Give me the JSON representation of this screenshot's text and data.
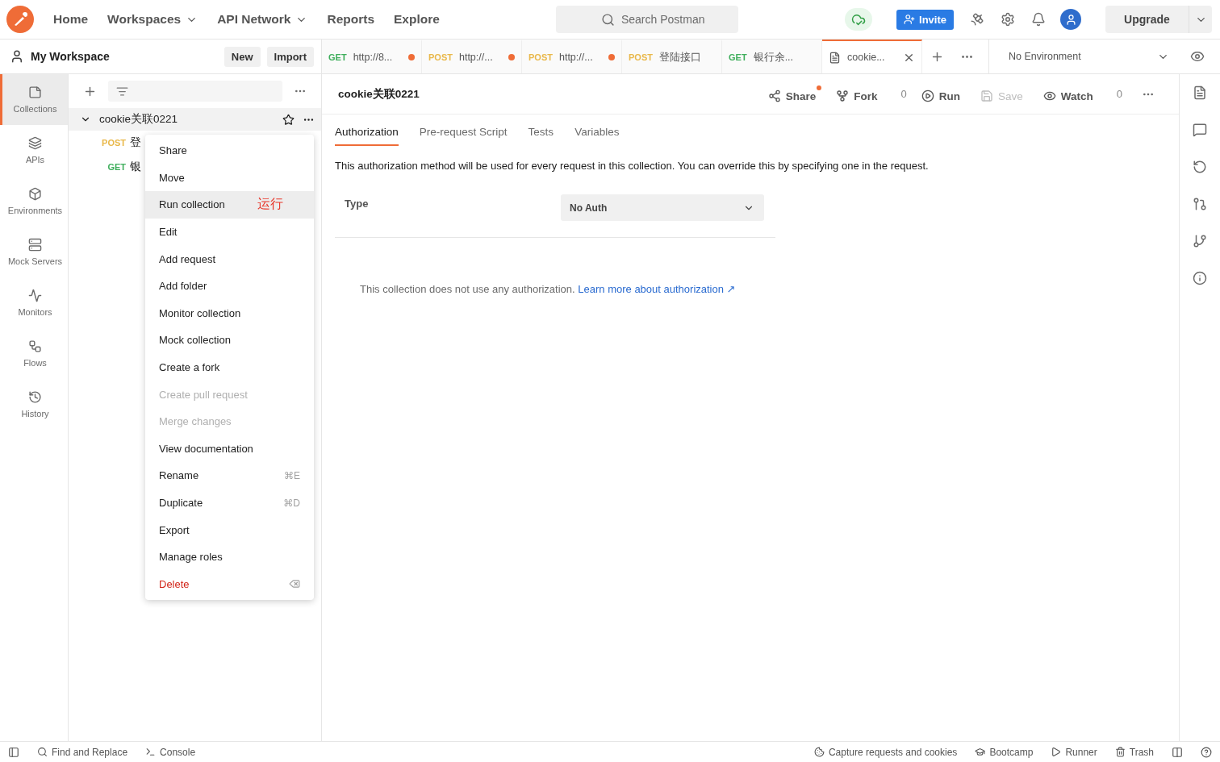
{
  "nav": [
    {
      "label": "Home",
      "dropdown": false
    },
    {
      "label": "Workspaces",
      "dropdown": true
    },
    {
      "label": "API Network",
      "dropdown": true
    },
    {
      "label": "Reports",
      "dropdown": false
    },
    {
      "label": "Explore",
      "dropdown": false
    }
  ],
  "search": {
    "placeholder": "Search Postman"
  },
  "invite": "Invite",
  "upgrade": "Upgrade",
  "workspace": {
    "title": "My Workspace",
    "buttons": [
      "New",
      "Import"
    ]
  },
  "request_tabs": [
    {
      "kind": "request",
      "method": "GET",
      "color": "#3fae5c",
      "label": "http://8...",
      "unsaved": true,
      "selected": false
    },
    {
      "kind": "request",
      "method": "POST",
      "color": "#e9b84a",
      "label": "http://...",
      "unsaved": true,
      "selected": false
    },
    {
      "kind": "request",
      "method": "POST",
      "color": "#e9b84a",
      "label": "http://...",
      "unsaved": true,
      "selected": false
    },
    {
      "kind": "request",
      "method": "POST",
      "color": "#e9b84a",
      "label": "登陆接口",
      "unsaved": false,
      "selected": false
    },
    {
      "kind": "request",
      "method": "GET",
      "color": "#3fae5c",
      "label": "银行余...",
      "unsaved": false,
      "selected": false
    },
    {
      "kind": "collection",
      "label": "cookie...",
      "unsaved": false,
      "selected": true
    }
  ],
  "environment": "No Environment",
  "rail": [
    {
      "label": "Collections",
      "selected": true
    },
    {
      "label": "APIs",
      "selected": false
    },
    {
      "label": "Environments",
      "selected": false
    },
    {
      "label": "Mock Servers",
      "selected": false
    },
    {
      "label": "Monitors",
      "selected": false
    },
    {
      "label": "Flows",
      "selected": false
    },
    {
      "label": "History",
      "selected": false
    }
  ],
  "tree": [
    {
      "name": "cookie关联0221",
      "expanded": true,
      "children": [
        {
          "method": "POST",
          "color": "#e9b84a",
          "name": "登"
        },
        {
          "method": "GET",
          "color": "#3fae5c",
          "name": "银"
        }
      ]
    }
  ],
  "context_menu": [
    {
      "kind": "action",
      "label": "Share",
      "disabled": false,
      "selected": false
    },
    {
      "kind": "action",
      "label": "Move",
      "disabled": false,
      "selected": false
    },
    {
      "kind": "action",
      "label": "Run collection",
      "disabled": false,
      "selected": true,
      "annotation": "运行"
    },
    {
      "kind": "action",
      "label": "Edit",
      "disabled": false,
      "selected": false
    },
    {
      "kind": "action",
      "label": "Add request",
      "disabled": false,
      "selected": false
    },
    {
      "kind": "action",
      "label": "Add folder",
      "disabled": false,
      "selected": false
    },
    {
      "kind": "action",
      "label": "Monitor collection",
      "disabled": false,
      "selected": false
    },
    {
      "kind": "action",
      "label": "Mock collection",
      "disabled": false,
      "selected": false
    },
    {
      "kind": "action",
      "label": "Create a fork",
      "disabled": false,
      "selected": false
    },
    {
      "kind": "action",
      "label": "Create pull request",
      "disabled": true,
      "selected": false
    },
    {
      "kind": "action",
      "label": "Merge changes",
      "disabled": true,
      "selected": false
    },
    {
      "kind": "action",
      "label": "View documentation",
      "disabled": false,
      "selected": false
    },
    {
      "kind": "action",
      "label": "Rename",
      "disabled": false,
      "selected": false,
      "shortcut": "⌘E"
    },
    {
      "kind": "action",
      "label": "Duplicate",
      "disabled": false,
      "selected": false,
      "shortcut": "⌘D"
    },
    {
      "kind": "action",
      "label": "Export",
      "disabled": false,
      "selected": false
    },
    {
      "kind": "action",
      "label": "Manage roles",
      "disabled": false,
      "selected": false
    },
    {
      "kind": "danger",
      "label": "Delete",
      "disabled": false,
      "selected": false
    }
  ],
  "collection": {
    "title": "cookie关联0221",
    "actions": [
      {
        "kind": "share",
        "label": "Share",
        "disabled": false,
        "notified": true
      },
      {
        "kind": "fork",
        "label": "Fork",
        "disabled": false,
        "notified": false,
        "count": "0"
      },
      {
        "kind": "run",
        "label": "Run",
        "disabled": false,
        "notified": false
      },
      {
        "kind": "save",
        "label": "Save",
        "disabled": true,
        "notified": false
      },
      {
        "kind": "watch",
        "label": "Watch",
        "disabled": false,
        "notified": false,
        "count": "0"
      }
    ],
    "tabs": [
      {
        "label": "Authorization",
        "selected": true
      },
      {
        "label": "Pre-request Script",
        "selected": false
      },
      {
        "label": "Tests",
        "selected": false
      },
      {
        "label": "Variables",
        "selected": false
      }
    ],
    "description": "This authorization method will be used for every request in this collection. You can override this by specifying one in the request.",
    "type_label": "Type",
    "type_value": "No Auth",
    "note": "This collection does not use any authorization.",
    "link": "Learn more about authorization ↗"
  },
  "status_bar": {
    "left": [
      {
        "kind": "search",
        "label": "Find and Replace"
      },
      {
        "kind": "console",
        "label": "Console"
      }
    ],
    "right": [
      {
        "kind": "capture",
        "label": "Capture requests and cookies"
      },
      {
        "kind": "bootcamp",
        "label": "Bootcamp"
      },
      {
        "kind": "runner",
        "label": "Runner"
      },
      {
        "kind": "trash",
        "label": "Trash"
      }
    ]
  }
}
